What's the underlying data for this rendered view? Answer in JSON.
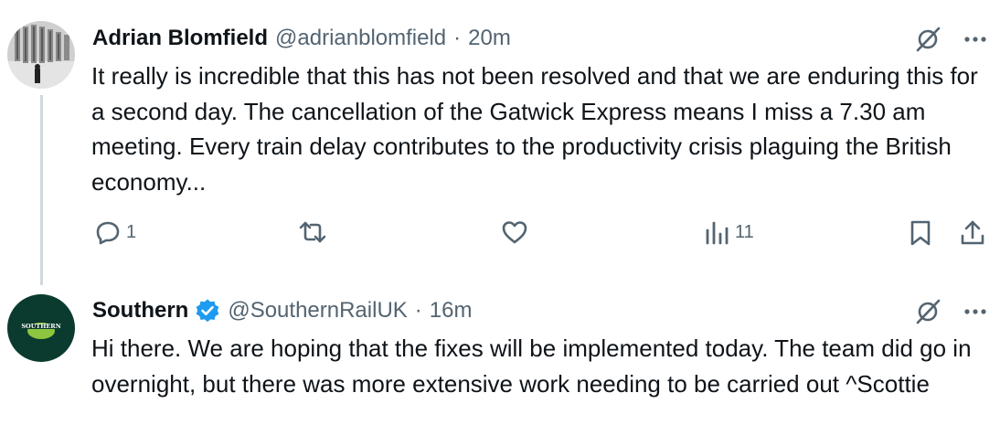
{
  "tweet1": {
    "name": "Adrian Blomfield",
    "handle": "@adrianblomfield",
    "separator": "·",
    "time": "20m",
    "text": "It really is incredible that this has not been resolved and that we are enduring this for a second day. The cancellation of the Gatwick Express means I miss a 7.30 am meeting. Every train delay contributes to the productivity crisis plaguing the British economy...",
    "replies": "1",
    "views": "11"
  },
  "tweet2": {
    "name": "Southern",
    "handle": "@SouthernRailUK",
    "separator": "·",
    "time": "16m",
    "text": "Hi there. We are hoping that the fixes will be implemented today. The team did go in overnight, but there was more extensive work needing to be carried out ^Scottie",
    "avatar_text": "SOUTHERN",
    "verified_color": "#1d9bf0"
  },
  "icons": [
    "grok-icon",
    "more-icon",
    "reply-icon",
    "retweet-icon",
    "like-icon",
    "views-icon",
    "bookmark-icon",
    "share-icon",
    "verified-badge-icon"
  ]
}
